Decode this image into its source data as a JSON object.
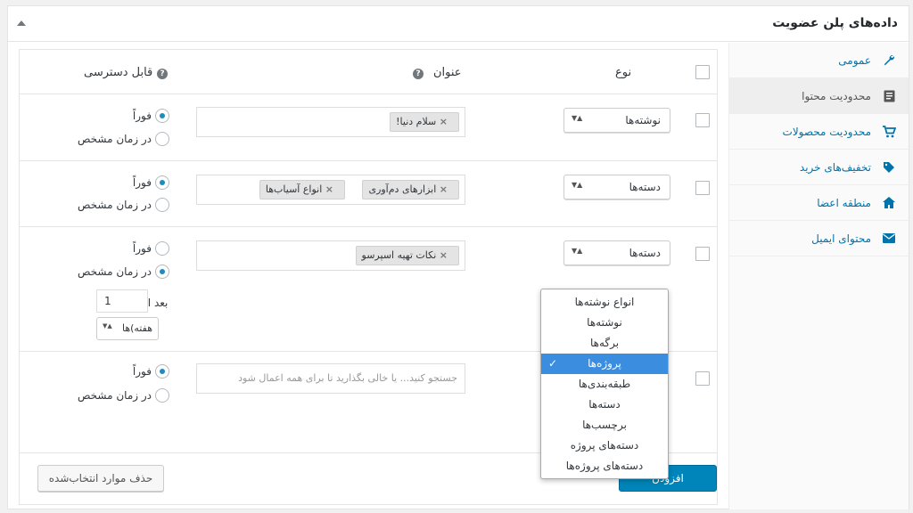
{
  "panel": {
    "title": "داده‌های پلن عضویت"
  },
  "sidebar": {
    "items": [
      {
        "label": "عمومی",
        "icon": "wrench-icon"
      },
      {
        "label": "محدودیت محتوا",
        "icon": "document-icon"
      },
      {
        "label": "محدودیت محصولات",
        "icon": "cart-icon"
      },
      {
        "label": "تخفیف‌های خرید",
        "icon": "tag-icon"
      },
      {
        "label": "منطقه اعضا",
        "icon": "home-icon"
      },
      {
        "label": "محتوای ایمیل",
        "icon": "envelope-icon"
      }
    ]
  },
  "table": {
    "headers": {
      "type": "نوع",
      "title": "عنوان",
      "access": "قابل دسترسی"
    },
    "help_glyph": "?",
    "tag_remove_glyph": "×",
    "select_arrow_glyph": "▲▼",
    "radio_labels": {
      "immediate": "فوراً",
      "scheduled": "در زمان مشخص"
    },
    "rows": [
      {
        "type": "نوشته‌ها",
        "tags": [
          "سلام دنیا!"
        ],
        "access": "immediate"
      },
      {
        "type": "دسته‌ها",
        "tags": [
          "ابزارهای دم‌آوری",
          "انواع آسیاب‌ها"
        ],
        "access": "immediate"
      },
      {
        "type": "دسته‌ها",
        "tags": [
          "نکات تهیه اسپرسو"
        ],
        "access": "scheduled",
        "after_label": "بعد از",
        "after_value": "1",
        "unit": "هفته)ها"
      },
      {
        "type": "",
        "tags": [],
        "placeholder": "جستجو کنید... یا خالی بگذارید تا برای همه اعمال شود",
        "access": "immediate"
      }
    ]
  },
  "buttons": {
    "delete_selected": "حذف موارد انتخاب‌شده",
    "add": "افزودن"
  },
  "dropdown": {
    "check_glyph": "✓",
    "selected_index": 3,
    "options": [
      "انواع نوشته‌ها",
      "نوشته‌ها",
      "برگه‌ها",
      "پروژه‌ها",
      "طبقه‌بندی‌ها",
      "دسته‌ها",
      "برچسب‌ها",
      "دسته‌های پروژه",
      "دسته‌های پروژه‌ها"
    ]
  },
  "colors": {
    "accent": "#0073aa",
    "primary_button": "#0085ba",
    "dropdown_selected": "#3b8de0"
  }
}
